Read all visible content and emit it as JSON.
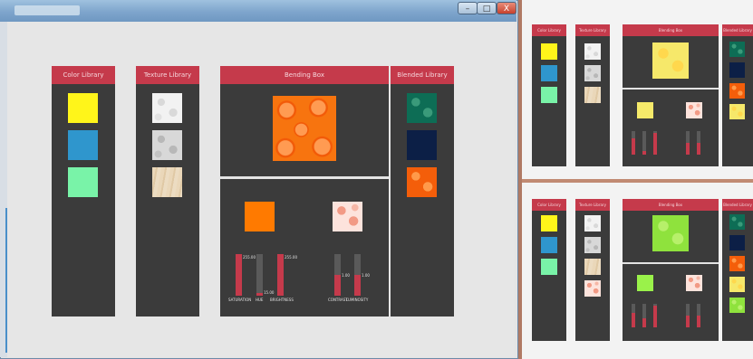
{
  "window": {
    "minimize_glyph": "–",
    "maximize_glyph": "□",
    "close_glyph": "X"
  },
  "panels": {
    "color_library": "Color Library",
    "texture_library": "Texture Library",
    "blending_box": "Bending Box",
    "blended_library": "Blended Library"
  },
  "colors": {
    "yellow": "#fff51a",
    "blue": "#2f96cd",
    "mint": "#79f3a8",
    "orange": "#ff7a00",
    "lime": "#9af24a",
    "accent": "#c53a4b",
    "panel": "#3b3b3b"
  },
  "adjust_main": {
    "saturation_value": "255.00",
    "hue_value": "15.00",
    "brightness_value": "255.00",
    "contrast_value": "1.00",
    "luminosity_value": "1.00",
    "saturation_label": "SATURATION",
    "hue_label": "HUE",
    "brightness_label": "BRIGHTNESS",
    "contrast_label": "CONTRAST",
    "luminosity_label": "LUMINOSITY",
    "saturation_level": 1.0,
    "hue_level": 0.05,
    "brightness_level": 1.0,
    "contrast_level": 0.5,
    "luminosity_level": 0.5
  },
  "thumb_top": {
    "color_library": "Color Library",
    "texture_library": "Texture Library",
    "blending_box": "Blending Box",
    "blended_library": "Blended Library"
  },
  "thumb_bottom": {
    "color_library": "Color Library",
    "texture_library": "Texture Library",
    "blending_box": "Blending Box",
    "blended_library": "Blended Library"
  }
}
